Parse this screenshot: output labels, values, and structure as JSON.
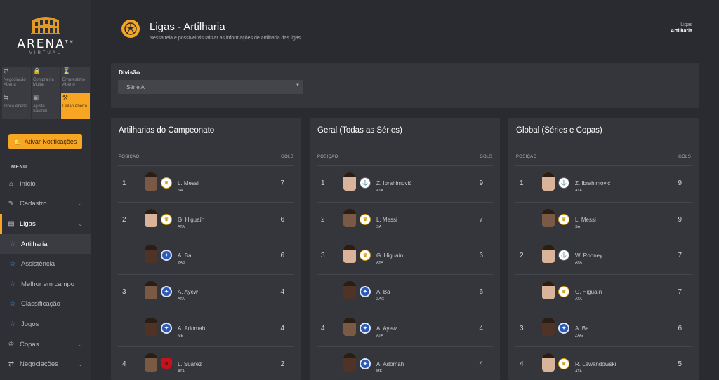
{
  "sidebar": {
    "logo_text": "ARENA",
    "logo_tm": "TM",
    "logo_sub": "VIRTUAL",
    "quick_links": [
      {
        "icon": "handshake-icon",
        "glyph": "⇄",
        "label": "Negociação Aberta",
        "active": false
      },
      {
        "icon": "lock-icon",
        "glyph": "🔒",
        "label": "Compra na Multa",
        "active": false
      },
      {
        "icon": "hourglass-icon",
        "glyph": "⌛",
        "label": "Empréstimo Aberto",
        "active": false
      },
      {
        "icon": "swap-icon",
        "glyph": "⇆",
        "label": "Troca Aberta",
        "active": false
      },
      {
        "icon": "money-icon",
        "glyph": "▣",
        "label": "Ajuste Salarial",
        "active": false
      },
      {
        "icon": "gavel-icon",
        "glyph": "⚒",
        "label": "Leilão Aberto",
        "active": true
      }
    ],
    "notif_button": "Ativar Notificações",
    "menu_title": "MENU",
    "menu": [
      {
        "key": "inicio",
        "icon": "home-icon",
        "glyph": "⌂",
        "label": "Início",
        "chevron": false,
        "type": "top"
      },
      {
        "key": "cadastro",
        "icon": "edit-icon",
        "glyph": "✎",
        "label": "Cadastro",
        "chevron": true,
        "type": "top"
      },
      {
        "key": "ligas",
        "icon": "ligas-icon",
        "glyph": "▤",
        "label": "Ligas",
        "chevron": true,
        "type": "open"
      },
      {
        "key": "artilharia",
        "icon": "star-icon",
        "glyph": "☆",
        "label": "Artilharia",
        "chevron": false,
        "type": "sub-active"
      },
      {
        "key": "assistencia",
        "icon": "star-icon",
        "glyph": "☆",
        "label": "Assistência",
        "chevron": false,
        "type": "sub"
      },
      {
        "key": "melhor",
        "icon": "star-icon",
        "glyph": "☆",
        "label": "Melhor em campo",
        "chevron": false,
        "type": "sub"
      },
      {
        "key": "classificacao",
        "icon": "star-icon",
        "glyph": "☆",
        "label": "Classificação",
        "chevron": false,
        "type": "sub"
      },
      {
        "key": "jogos",
        "icon": "star-icon",
        "glyph": "☆",
        "label": "Jogos",
        "chevron": false,
        "type": "sub"
      },
      {
        "key": "copas",
        "icon": "trophy-icon",
        "glyph": "♔",
        "label": "Copas",
        "chevron": true,
        "type": "top"
      },
      {
        "key": "negociacoes",
        "icon": "handshake-icon",
        "glyph": "⇄",
        "label": "Negociações",
        "chevron": true,
        "type": "top"
      }
    ]
  },
  "header": {
    "title": "Ligas - Artilharia",
    "subtitle": "Nessa tela é possível visualizar as informações de artilharia das ligas.",
    "breadcrumb": [
      "Ligas",
      "Artilharia"
    ]
  },
  "filter": {
    "label": "Divisão",
    "selected": "Série A"
  },
  "cards": [
    {
      "title": "Artilharias do Campeonato",
      "col_pos": "POSIÇÃO",
      "col_gols": "GOLS",
      "rows": [
        {
          "pos": "1",
          "name": "L. Messi",
          "role": "SA",
          "goals": "7",
          "club": "rm",
          "skin": "mid"
        },
        {
          "pos": "2",
          "name": "G. Higuaín",
          "role": "ATA",
          "goals": "6",
          "club": "rm",
          "skin": "light"
        },
        {
          "pos": "",
          "name": "A. Ba",
          "role": "ZAG",
          "goals": "6",
          "club": "lei",
          "skin": "dark"
        },
        {
          "pos": "3",
          "name": "A. Ayew",
          "role": "ATA",
          "goals": "4",
          "club": "lei",
          "skin": "mid"
        },
        {
          "pos": "",
          "name": "A. Adomah",
          "role": "ME",
          "goals": "4",
          "club": "lei",
          "skin": "dark"
        },
        {
          "pos": "4",
          "name": "L. Suárez",
          "role": "ATA",
          "goals": "2",
          "club": "fla",
          "skin": "mid"
        }
      ]
    },
    {
      "title": "Geral (Todas as Séries)",
      "col_pos": "POSIÇÃO",
      "col_gols": "GOLS",
      "rows": [
        {
          "pos": "1",
          "name": "Z. Ibrahimović",
          "role": "ATA",
          "goals": "9",
          "club": "cor",
          "skin": "light"
        },
        {
          "pos": "2",
          "name": "L. Messi",
          "role": "SA",
          "goals": "7",
          "club": "rm",
          "skin": "mid"
        },
        {
          "pos": "3",
          "name": "G. Higuaín",
          "role": "ATA",
          "goals": "6",
          "club": "rm",
          "skin": "light"
        },
        {
          "pos": "",
          "name": "A. Ba",
          "role": "ZAG",
          "goals": "6",
          "club": "lei",
          "skin": "dark"
        },
        {
          "pos": "4",
          "name": "A. Ayew",
          "role": "ATA",
          "goals": "4",
          "club": "lei",
          "skin": "mid"
        },
        {
          "pos": "",
          "name": "A. Adomah",
          "role": "ME",
          "goals": "4",
          "club": "lei",
          "skin": "dark"
        }
      ]
    },
    {
      "title": "Global (Séries e Copas)",
      "col_pos": "POSIÇÃO",
      "col_gols": "GOLS",
      "rows": [
        {
          "pos": "1",
          "name": "Z. Ibrahimović",
          "role": "ATA",
          "goals": "9",
          "club": "cor",
          "skin": "light"
        },
        {
          "pos": "",
          "name": "L. Messi",
          "role": "SA",
          "goals": "9",
          "club": "rm",
          "skin": "mid"
        },
        {
          "pos": "2",
          "name": "W. Rooney",
          "role": "ATA",
          "goals": "7",
          "club": "cor",
          "skin": "light"
        },
        {
          "pos": "",
          "name": "G. Higuaín",
          "role": "ATA",
          "goals": "7",
          "club": "rm",
          "skin": "light"
        },
        {
          "pos": "3",
          "name": "A. Ba",
          "role": "ZAG",
          "goals": "6",
          "club": "lei",
          "skin": "dark"
        },
        {
          "pos": "4",
          "name": "R. Lewandowski",
          "role": "ATA",
          "goals": "5",
          "club": "rm",
          "skin": "light"
        }
      ]
    }
  ],
  "colors": {
    "accent": "#f6a623",
    "background": "#2a2b30",
    "card": "#34363b",
    "sub_icon": "#4c93e8"
  }
}
